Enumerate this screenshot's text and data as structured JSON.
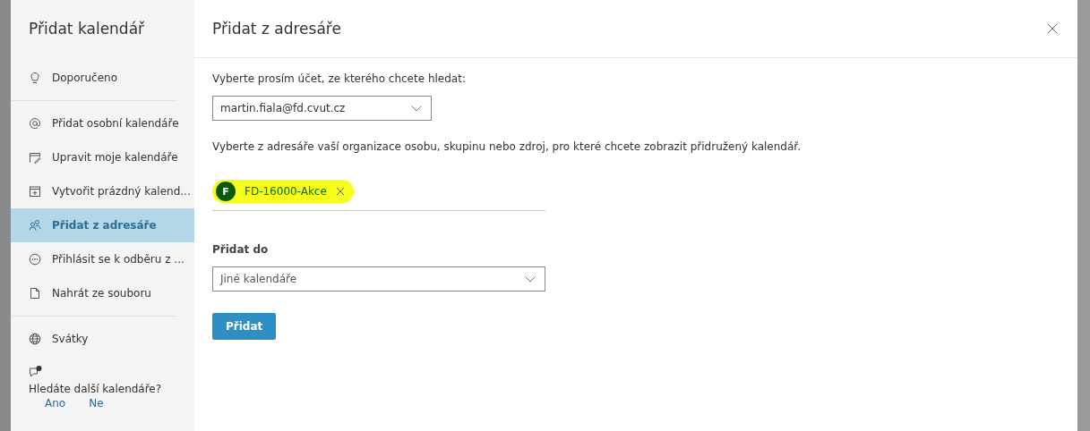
{
  "sidebar": {
    "title": "Přidat kalendář",
    "groups": [
      [
        {
          "label": "Doporučeno",
          "kind": "bulb",
          "selected": false
        }
      ],
      [
        {
          "label": "Přidat osobní kalendáře",
          "kind": "at",
          "selected": false
        },
        {
          "label": "Upravit moje kalendáře",
          "kind": "edit",
          "selected": false
        },
        {
          "label": "Vytvořit prázdný kalend...",
          "kind": "calendar",
          "selected": false
        },
        {
          "label": "Přidat z adresáře",
          "kind": "people",
          "selected": true
        },
        {
          "label": "Přihlásit se k odběru z ...",
          "kind": "dots",
          "selected": false
        },
        {
          "label": "Nahrát ze souboru",
          "kind": "file",
          "selected": false
        }
      ],
      [
        {
          "label": "Svátky",
          "kind": "globe",
          "selected": false
        }
      ]
    ],
    "feedback": {
      "question": "Hledáte další kalendáře?",
      "links": [
        "Ano",
        "Ne"
      ]
    }
  },
  "dialog": {
    "title": "Přidat z adresáře",
    "account_label": "Vyberte prosím účet, ze kterého chcete hledat:",
    "account_value": "martin.fiala@fd.cvut.cz",
    "directory_prompt": "Vyberte z adresáře vaší organizace osobu, skupinu nebo zdroj, pro které chcete zobrazit přidružený kalendář.",
    "selected_people": [
      {
        "initial": "F",
        "name": "FD-16000-Akce",
        "color": "#0b5a0b",
        "highlighted": true
      }
    ],
    "add_to_label": "Přidat do",
    "add_to_value": "Jiné kalendáře",
    "submit": "Přidat"
  }
}
